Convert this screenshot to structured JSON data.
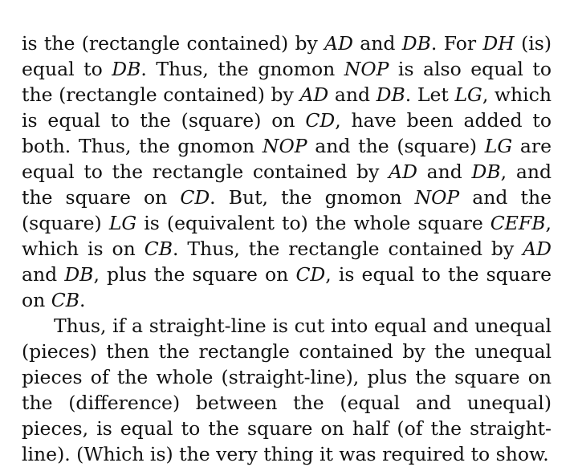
{
  "paragraphs": [
    {
      "indent": false,
      "runs": [
        {
          "t": "is the (rectangle contained) by "
        },
        {
          "t": "AD",
          "math": true
        },
        {
          "t": " and "
        },
        {
          "t": "DB",
          "math": true
        },
        {
          "t": ".  For "
        },
        {
          "t": "DH",
          "math": true
        },
        {
          "t": " (is) equal to "
        },
        {
          "t": "DB",
          "math": true
        },
        {
          "t": ". Thus, the gnomon "
        },
        {
          "t": "NOP",
          "math": true
        },
        {
          "t": " is also equal to the (rectangle contained) by "
        },
        {
          "t": "AD",
          "math": true
        },
        {
          "t": " and "
        },
        {
          "t": "DB",
          "math": true
        },
        {
          "t": ".  Let "
        },
        {
          "t": "LG",
          "math": true
        },
        {
          "t": ", which is equal to the (square) on "
        },
        {
          "t": "CD",
          "math": true
        },
        {
          "t": ", have been added to both. Thus, the gnomon "
        },
        {
          "t": "NOP",
          "math": true
        },
        {
          "t": " and the (square) "
        },
        {
          "t": "LG",
          "math": true
        },
        {
          "t": " are equal to the rectangle contained by "
        },
        {
          "t": "AD",
          "math": true
        },
        {
          "t": " and "
        },
        {
          "t": "DB",
          "math": true
        },
        {
          "t": ", and the square on "
        },
        {
          "t": "CD",
          "math": true
        },
        {
          "t": ". But, the gnomon "
        },
        {
          "t": "NOP",
          "math": true
        },
        {
          "t": " and the (square) "
        },
        {
          "t": "LG",
          "math": true
        },
        {
          "t": " is (equivalent to) the whole square "
        },
        {
          "t": "CEFB",
          "math": true
        },
        {
          "t": ", which is on "
        },
        {
          "t": "CB",
          "math": true
        },
        {
          "t": ".  Thus, the rectangle contained by "
        },
        {
          "t": "AD",
          "math": true
        },
        {
          "t": " and "
        },
        {
          "t": "DB",
          "math": true
        },
        {
          "t": ", plus the square on "
        },
        {
          "t": "CD",
          "math": true
        },
        {
          "t": ", is equal to the square on "
        },
        {
          "t": "CB",
          "math": true
        },
        {
          "t": "."
        }
      ]
    },
    {
      "indent": true,
      "runs": [
        {
          "t": "Thus, if a straight-line is cut into equal and unequal (pieces) then the rectangle contained by the unequal pieces of the whole (straight-line), plus the square on the (difference) between the (equal and unequal) pieces, is equal to the square on half (of the straight-line). (Which is) the very thing it was required to show."
        }
      ]
    }
  ]
}
